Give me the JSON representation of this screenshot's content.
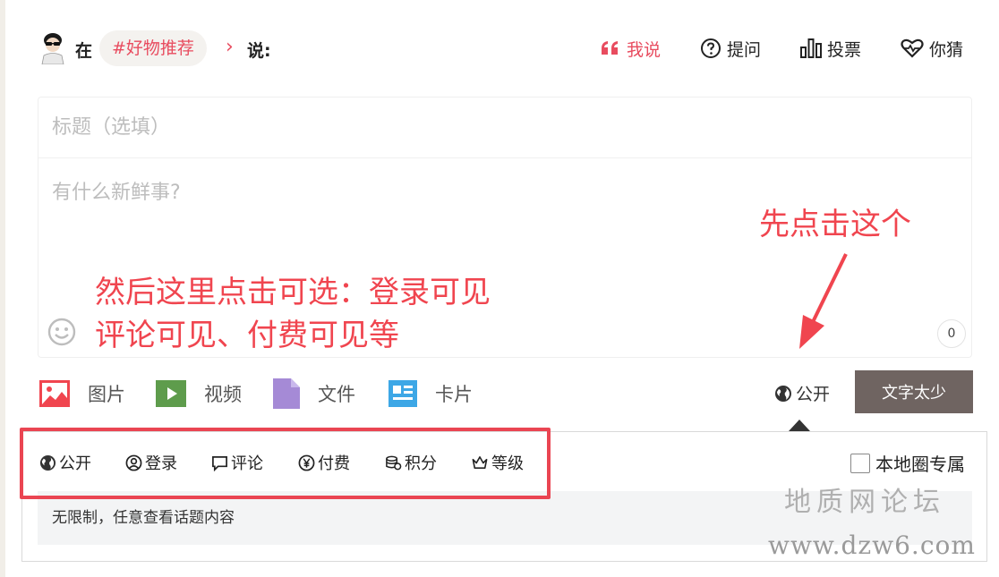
{
  "header": {
    "in_label": "在",
    "topic": "#好物推荐",
    "say_label": "说:",
    "tabs": [
      {
        "label": "我说",
        "icon": "quote-icon",
        "active": true
      },
      {
        "label": "提问",
        "icon": "question-icon"
      },
      {
        "label": "投票",
        "icon": "bar-chart-icon"
      },
      {
        "label": "你猜",
        "icon": "heart-pulse-icon"
      }
    ]
  },
  "editor": {
    "title_placeholder": "标题（选填）",
    "body_placeholder": "有什么新鲜事?",
    "char_count": "0"
  },
  "toolbar": {
    "items": [
      {
        "label": "图片",
        "icon": "image-icon",
        "color": "#f0454f"
      },
      {
        "label": "视频",
        "icon": "video-icon",
        "color": "#5e9c4c"
      },
      {
        "label": "文件",
        "icon": "file-icon",
        "color": "#a58ad6"
      },
      {
        "label": "卡片",
        "icon": "card-icon",
        "color": "#3da7e6"
      }
    ],
    "visibility_label": "公开",
    "submit_label": "文字太少"
  },
  "visibility_menu": {
    "options": [
      {
        "label": "公开",
        "icon": "globe-icon"
      },
      {
        "label": "登录",
        "icon": "user-circle-icon"
      },
      {
        "label": "评论",
        "icon": "comment-icon"
      },
      {
        "label": "付费",
        "icon": "yen-icon"
      },
      {
        "label": "积分",
        "icon": "coins-icon"
      },
      {
        "label": "等级",
        "icon": "crown-icon"
      }
    ],
    "local_only_label": "本地圈专属",
    "local_only_checked": false,
    "description": "无限制，任意查看话题内容"
  },
  "annotations": {
    "click_first": "先点击这个",
    "then_line1": "然后这里点击可选：登录可见",
    "then_line2": "评论可见、付费可见等"
  },
  "watermark": {
    "name": "地质网论坛",
    "url": "www.dzw6.com"
  },
  "colors": {
    "accent": "#e84c5f",
    "annotation": "#f0454f",
    "submit_bg": "#6f6461"
  }
}
